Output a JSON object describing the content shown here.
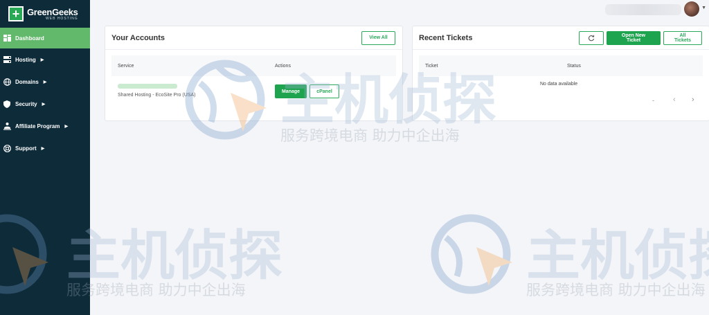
{
  "brand": {
    "name": "GreenGeeks",
    "subtitle": "WEB HOSTING",
    "accent": "#1ea34e",
    "sidebar_bg": "#0e2b3a"
  },
  "sidebar": {
    "items": [
      {
        "label": "Dashboard",
        "icon": "dashboard-icon",
        "active": true
      },
      {
        "label": "Hosting",
        "icon": "server-icon"
      },
      {
        "label": "Domains",
        "icon": "globe-icon"
      },
      {
        "label": "Security",
        "icon": "shield-icon"
      },
      {
        "label": "Affiliate Program",
        "icon": "affiliate-icon"
      },
      {
        "label": "Support",
        "icon": "support-icon"
      }
    ]
  },
  "accounts": {
    "title": "Your Accounts",
    "view_all": "View All",
    "columns": {
      "service": "Service",
      "actions": "Actions"
    },
    "row": {
      "service": "Shared Hosting - EcoSite Pro (USA)",
      "manage": "Manage",
      "cpanel": "cPanel"
    }
  },
  "tickets": {
    "title": "Recent Tickets",
    "refresh_icon": "refresh-icon",
    "open_new": "Open New Ticket",
    "all_tickets": "All Tickets",
    "columns": {
      "ticket": "Ticket",
      "status": "Status"
    },
    "empty": "No data available",
    "pager": {
      "dash": "-",
      "prev": "‹",
      "next": "›"
    }
  },
  "watermark": {
    "big": "主机侦探",
    "small": "服务跨境电商 助力中企出海"
  }
}
